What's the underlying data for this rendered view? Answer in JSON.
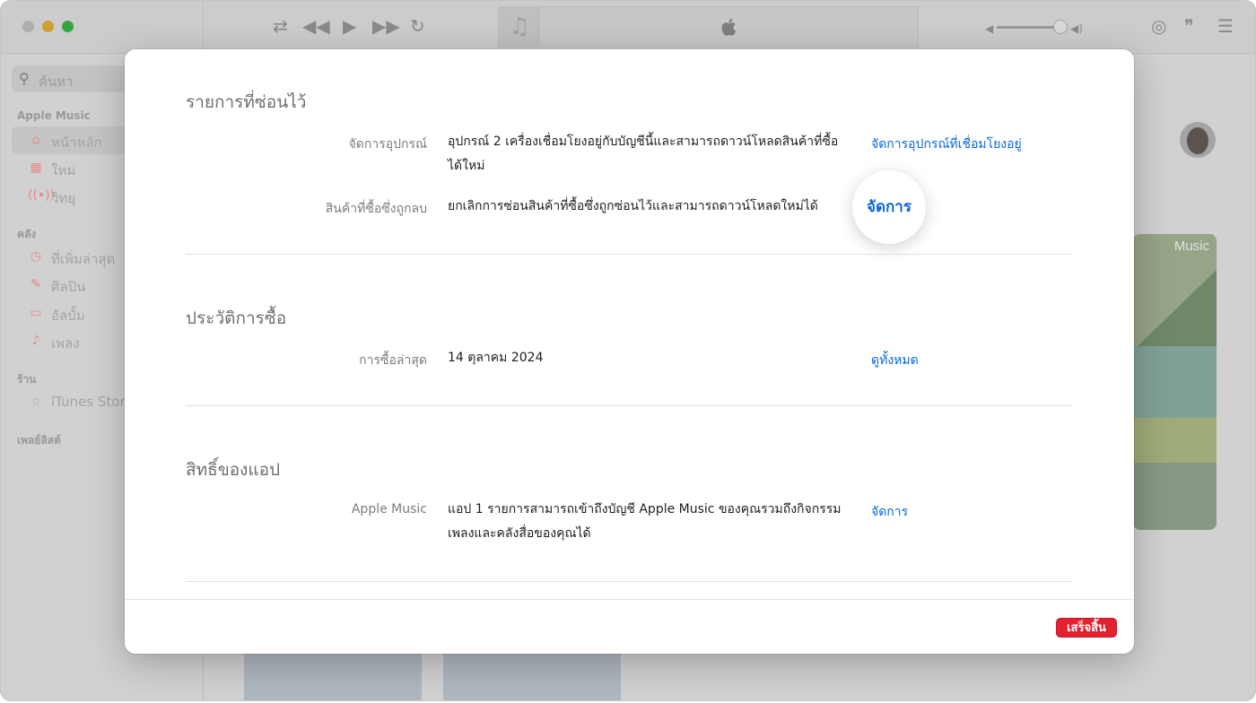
{
  "toolbar": {
    "shuffle_icon": "shuffle-icon",
    "previous_icon": "previous-icon",
    "play_icon": "play-icon",
    "next_icon": "next-icon",
    "repeat_icon": "repeat-icon",
    "airplay_icon": "airplay-icon",
    "lyrics_icon": "lyrics-icon",
    "queue_icon": "queue-icon"
  },
  "sidebar": {
    "search_placeholder": "ค้นหา",
    "sections": {
      "apple_music": "Apple Music",
      "library": "คลัง",
      "store": "ร้าน",
      "playlists": "เพลย์ลิสต์"
    },
    "items": [
      {
        "label": "หน้าหลัก",
        "icon": "home-icon"
      },
      {
        "label": "ใหม่",
        "icon": "grid-icon"
      },
      {
        "label": "วิทยุ",
        "icon": "radio-icon"
      },
      {
        "label": "ที่เพิ่มล่าสุด",
        "icon": "clock-icon"
      },
      {
        "label": "ศิลปิน",
        "icon": "microphone-icon"
      },
      {
        "label": "อัลบั้ม",
        "icon": "album-icon"
      },
      {
        "label": "เพลง",
        "icon": "note-icon"
      },
      {
        "label": "iTunes Store",
        "icon": "star-icon"
      }
    ]
  },
  "background": {
    "art_label": "Music"
  },
  "modal": {
    "hidden_items": {
      "title": "รายการที่ซ่อนไว้",
      "manage_devices": {
        "label": "จัดการอุปกรณ์",
        "description": "อุปกรณ์ 2 เครื่องเชื่อมโยงอยู่กับบัญชีนี้และสามารถดาวน์โหลดสินค้าที่ซื้อได้ใหม่",
        "link": "จัดการอุปกรณ์ที่เชื่อมโยงอยู่"
      },
      "hidden_purchases": {
        "label": "สินค้าที่ซื้อซึ่งถูกลบ",
        "description": "ยกเลิกการซ่อนสินค้าที่ซื้อซึ่งถูกซ่อนไว้และสามารถดาวน์โหลดใหม่ได้",
        "link": "จัดการ"
      }
    },
    "purchase_history": {
      "title": "ประวัติการซื้อ",
      "recent": {
        "label": "การซื้อล่าสุด",
        "value": "14 ตุลาคม 2024",
        "link": "ดูทั้งหมด"
      }
    },
    "app_permissions": {
      "title": "สิทธิ์ของแอป",
      "apple_music": {
        "label": "Apple Music",
        "description": "แอป 1 รายการสามารถเข้าถึงบัญชี Apple Music ของคุณรวมถึงกิจกรรมเพลงและคลังสื่อของคุณได้",
        "link": "จัดการ"
      }
    },
    "done_button": "เสร็จสิ้น"
  }
}
